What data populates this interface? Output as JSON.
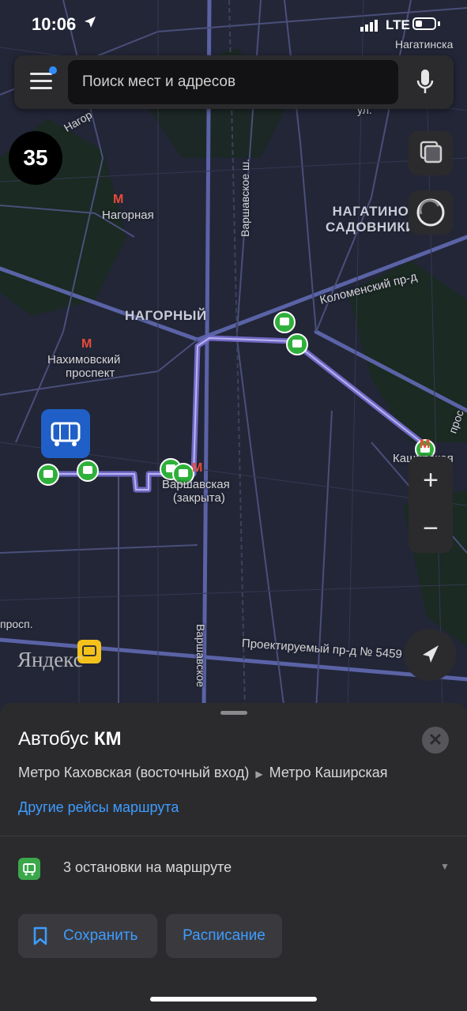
{
  "status_bar": {
    "time": "10:06",
    "network": "LTE"
  },
  "search": {
    "placeholder": "Поиск мест и адресов"
  },
  "map": {
    "speed": "35",
    "labels": {
      "nagornaya_metro": "Нагорная",
      "nagatino": "НАГАТИНО",
      "sadovniki": "САДОВНИКИ",
      "nagorny": "НАГОРНЫЙ",
      "nakhimovsky_1": "Нахимовский",
      "nakhimovsky_2": "проспект",
      "varshavskaya_1": "Варшавская",
      "varshavskaya_2": "(закрыта)",
      "kashirskaya": "Каширская",
      "kolomensky": "Коломенский пр-д",
      "varshavskoe_sh_top": "Варшавское ш.",
      "varshavskoe_bottom": "Варшавское",
      "proektiruemy": "Проектируемый пр-д № 5459",
      "nagatinskaya": "Нагатинска",
      "ul": "ул.",
      "nagor": "Нагор",
      "prosp": "просп.",
      "prosp_right": "прос"
    },
    "watermark": "Яндекс",
    "route_color": "#6f68c4",
    "stop_color": "#2fb03b"
  },
  "sheet": {
    "title_prefix": "Автобус",
    "title_route": "КМ",
    "from": "Метро Каховская (восточный вход)",
    "to": "Метро Каширская",
    "other_trips": "Другие рейсы маршрута",
    "stops_count_label": "3 остановки на маршруте",
    "save_label": "Сохранить",
    "schedule_label": "Расписание"
  }
}
